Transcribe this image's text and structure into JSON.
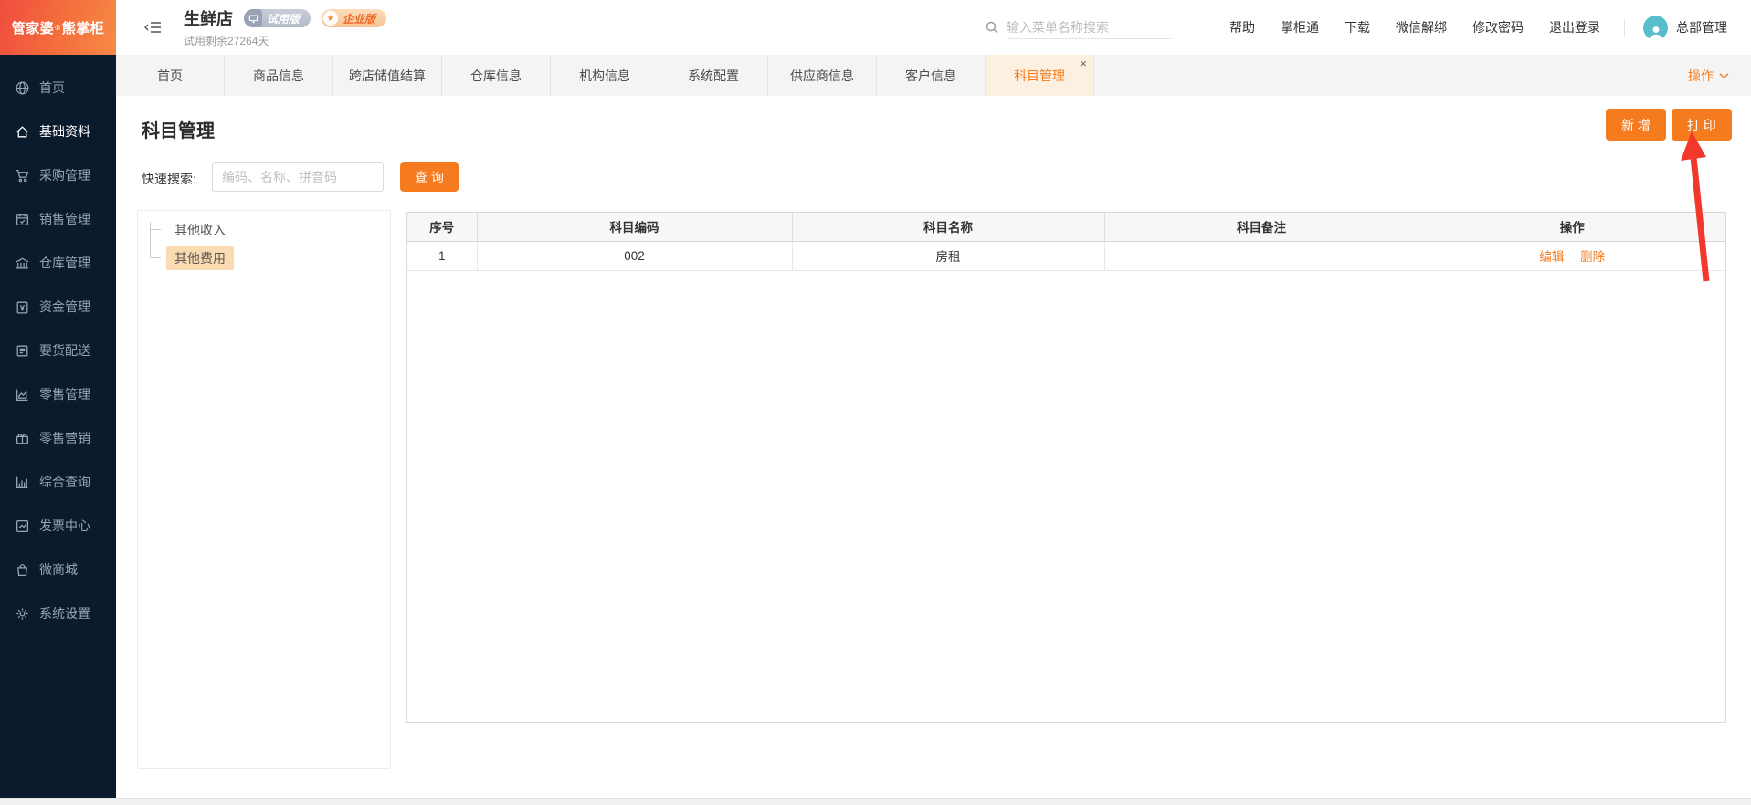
{
  "brand": {
    "name": "管家婆",
    "reg": "®",
    "product": "熊掌柜"
  },
  "header": {
    "store_name": "生鲜店",
    "trial_badge": "试用版",
    "edition_badge": "企业版",
    "trial_remaining": "试用剩余27264天",
    "search_placeholder": "输入菜单名称搜索",
    "menu": [
      "帮助",
      "掌柜通",
      "下载",
      "微信解绑",
      "修改密码",
      "退出登录"
    ],
    "user": "总部管理"
  },
  "tabs": {
    "items": [
      {
        "label": "首页"
      },
      {
        "label": "商品信息"
      },
      {
        "label": "跨店储值结算"
      },
      {
        "label": "仓库信息"
      },
      {
        "label": "机构信息"
      },
      {
        "label": "系统配置"
      },
      {
        "label": "供应商信息"
      },
      {
        "label": "客户信息"
      },
      {
        "label": "科目管理",
        "closable": true,
        "active": true
      }
    ],
    "actions_label": "操作"
  },
  "sidebar": {
    "items": [
      {
        "label": "首页"
      },
      {
        "label": "基础资料",
        "active": true
      },
      {
        "label": "采购管理"
      },
      {
        "label": "销售管理"
      },
      {
        "label": "仓库管理"
      },
      {
        "label": "资金管理"
      },
      {
        "label": "要货配送"
      },
      {
        "label": "零售管理"
      },
      {
        "label": "零售营销"
      },
      {
        "label": "综合查询"
      },
      {
        "label": "发票中心"
      },
      {
        "label": "微商城"
      },
      {
        "label": "系统设置"
      }
    ]
  },
  "page": {
    "title": "科目管理",
    "new_button": "新 增",
    "print_button": "打 印",
    "quick_search_label": "快速搜索:",
    "quick_search_placeholder": "编码、名称、拼音码",
    "query_button": "查 询"
  },
  "tree": {
    "items": [
      {
        "label": "其他收入",
        "selected": false
      },
      {
        "label": "其他费用",
        "selected": true
      }
    ]
  },
  "table": {
    "columns": [
      "序号",
      "科目编码",
      "科目名称",
      "科目备注",
      "操作"
    ],
    "rows": [
      {
        "seq": "1",
        "code": "002",
        "name": "房租",
        "note": "",
        "edit": "编辑",
        "delete": "删除"
      }
    ]
  },
  "icons": {
    "close": "×",
    "star": "★"
  },
  "colors": {
    "accent": "#F57B1E",
    "sidebar_bg": "#0A1B2E",
    "active_tab_bg": "#FCF0E1",
    "tree_selected_bg": "#FBDCB2",
    "annotation_arrow": "#F2382C",
    "avatar_bg": "#58BECB"
  }
}
